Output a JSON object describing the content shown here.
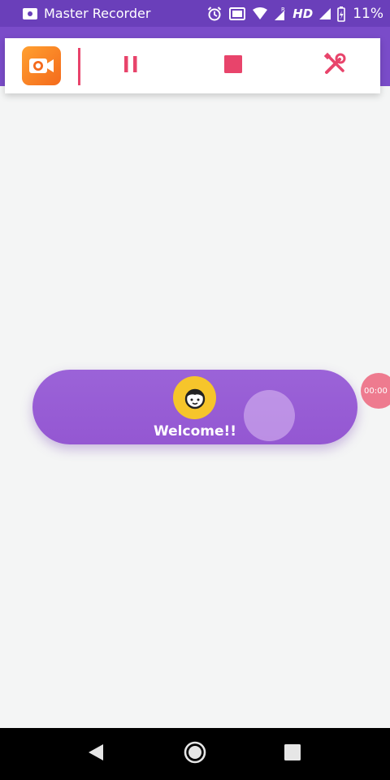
{
  "status_bar": {
    "app_name": "Master Recorder",
    "network_label": "HD",
    "battery_percent": "11%",
    "icons": [
      "video-recorder-icon",
      "alarm-icon",
      "cast-icon",
      "wifi-icon",
      "signal-roaming-icon",
      "signal-icon",
      "battery-charging-icon"
    ]
  },
  "toolbar": {
    "logo_icon": "camera-icon",
    "buttons": [
      {
        "name": "pause",
        "icon": "pause-icon"
      },
      {
        "name": "stop",
        "icon": "stop-icon"
      },
      {
        "name": "tools",
        "icon": "tools-icon"
      }
    ],
    "accent_color": "#e8446b"
  },
  "welcome": {
    "text": "Welcome!!",
    "avatar_icon": "boy-face-icon"
  },
  "timer_bubble": {
    "text": "00:00"
  },
  "nav_bar": {
    "buttons": [
      "back-icon",
      "home-icon",
      "recents-icon"
    ]
  },
  "colors": {
    "status_bar": "#6a3fba",
    "toolbar_band": "#7a4cc9",
    "pill": "#9b63d8",
    "avatar_bg": "#f6c52b",
    "timer_bubble": "#ee7b8f",
    "background": "#f4f5f5"
  }
}
